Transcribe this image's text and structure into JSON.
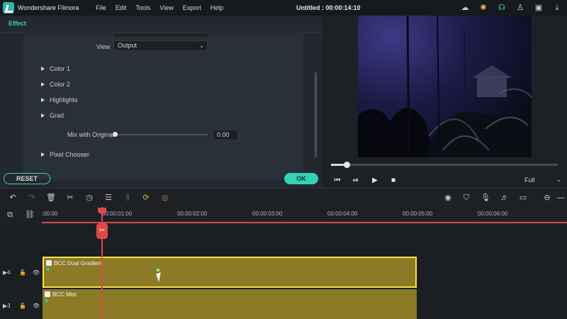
{
  "titlebar": {
    "app_name": "Wondershare Filmora",
    "menu": [
      "File",
      "Edit",
      "Tools",
      "View",
      "Export",
      "Help"
    ],
    "doc_title": "Untitled : 00:00:14:10"
  },
  "effect_panel": {
    "tab": "Effect",
    "view_label": "View",
    "view_value": "Output",
    "properties": [
      "Color 1",
      "Color 2",
      "Highlights",
      "Grad"
    ],
    "mix_label": "Mix with Original",
    "mix_value": "0.00",
    "mix_fraction": 0,
    "pixel_chooser": "Pixel Chooser",
    "reset_label": "RESET",
    "ok_label": "OK"
  },
  "preview": {
    "progress_fraction": 0.07,
    "zoom": "Full"
  },
  "timeline": {
    "ruler_labels": [
      ":00:00",
      "00:00:01:00",
      "00:00:02:00",
      "00:00:03:00",
      "00:00:04:00",
      "00:00:05:00",
      "00:00:06:00"
    ],
    "tracks": [
      {
        "number": "4",
        "clip_name": "BCC Dual Gradient"
      },
      {
        "number": "3",
        "clip_name": "BCC Mist"
      }
    ]
  },
  "colors": {
    "accent": "#35d1b8",
    "playhead": "#e04848",
    "clip": "#8b7a26",
    "clip_selected_border": "#ffe14a"
  }
}
